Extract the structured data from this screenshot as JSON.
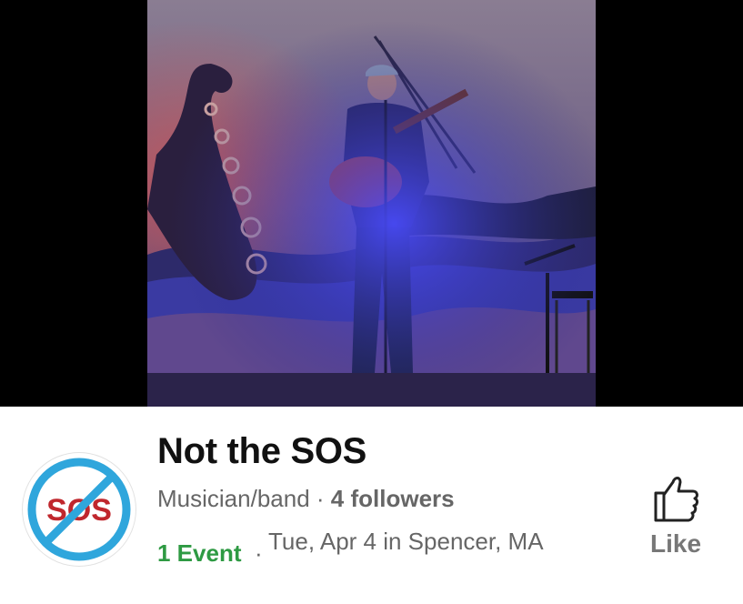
{
  "page": {
    "name": "Not the SOS",
    "category": "Musician/band",
    "separator": "·",
    "followers": "4 followers",
    "events_count": "1 Event",
    "event_detail": "Tue, Apr 4 in Spencer, MA"
  },
  "avatar": {
    "logo_text": "SOS"
  },
  "actions": {
    "like_label": "Like"
  },
  "colors": {
    "event_green": "#2e9a43",
    "logo_red": "#c0272d",
    "logo_blue": "#2fa6dc",
    "stage_light": "#3a3aff"
  }
}
